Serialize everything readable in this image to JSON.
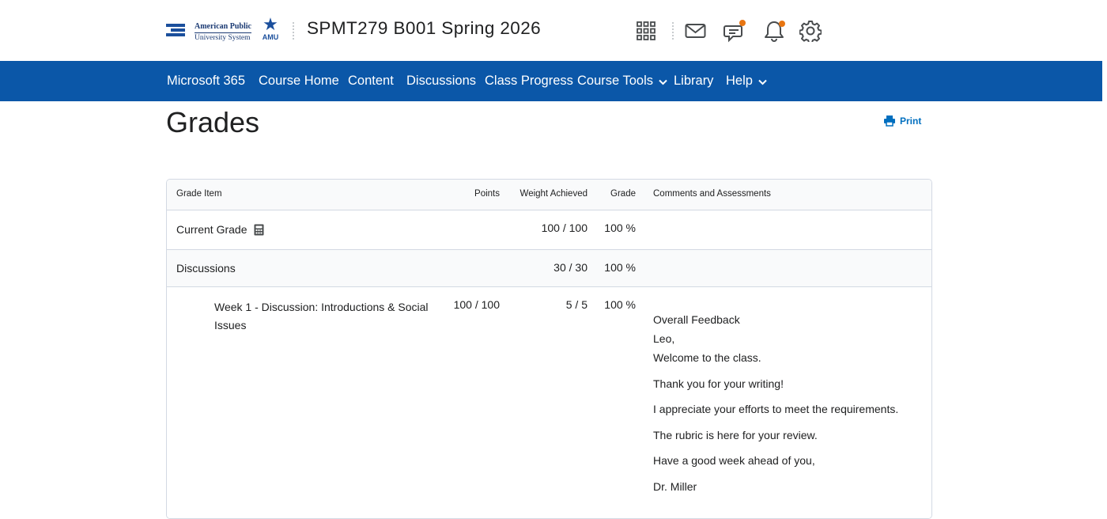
{
  "header": {
    "logo": {
      "line1": "American Public",
      "line2": "University System",
      "badge": "AMU"
    },
    "course_title": "SPMT279 B001 Spring 2026",
    "icons": [
      "apps-grid-icon",
      "mail-icon",
      "chat-icon",
      "bell-icon",
      "gear-icon"
    ],
    "notification_color": "#e87511"
  },
  "nav": {
    "background": "#0b57a8",
    "items": [
      {
        "label": "Microsoft 365"
      },
      {
        "label": "Course Home"
      },
      {
        "label": "Content"
      },
      {
        "label": "Discussions"
      },
      {
        "label": "Class Progress"
      },
      {
        "label": "Course Tools",
        "has_dropdown": true
      },
      {
        "label": "Library"
      },
      {
        "label": "Help",
        "has_dropdown": true
      }
    ]
  },
  "page": {
    "title": "Grades",
    "print_label": "Print"
  },
  "table": {
    "columns": {
      "grade_item": "Grade Item",
      "points": "Points",
      "weight_achieved": "Weight Achieved",
      "grade": "Grade",
      "comments": "Comments and Assessments"
    },
    "rows": [
      {
        "name": "Current Grade",
        "points": "",
        "weight_achieved": "100 / 100",
        "grade": "100 %",
        "has_calculator_icon": true
      },
      {
        "name": "Discussions",
        "points": "",
        "weight_achieved": "30 / 30",
        "grade": "100 %"
      },
      {
        "name_line1": "Week 1 - Discussion: Introductions & Social",
        "name_line2": "Issues",
        "points": "100 / 100",
        "weight_achieved": "5 / 5",
        "grade": "100 %",
        "feedback": {
          "title": "Overall Feedback",
          "greeting": "Leo,",
          "lines": [
            "Welcome to the class.",
            "Thank you for your writing!",
            "I appreciate your efforts to meet the requirements.",
            "The rubric is here for your review.",
            "Have a good week ahead of you,",
            "Dr. Miller"
          ]
        }
      }
    ]
  }
}
